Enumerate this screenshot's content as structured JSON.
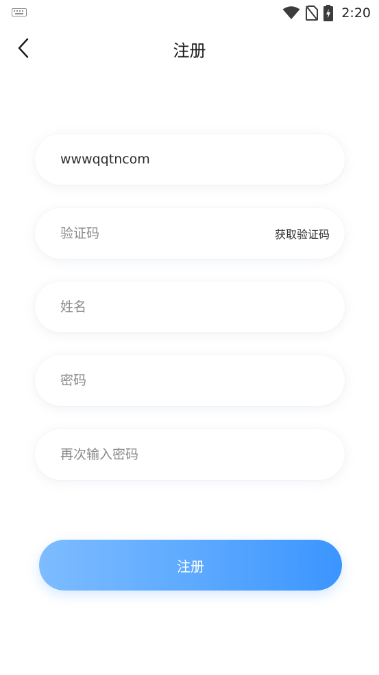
{
  "status_bar": {
    "time": "2:20",
    "icons": [
      "keyboard-icon",
      "wifi-icon",
      "no-sim-icon",
      "battery-charging-icon"
    ]
  },
  "header": {
    "back_icon": "chevron-left-icon",
    "title": "注册"
  },
  "form": {
    "account": {
      "value": "wwwqqtncom",
      "placeholder": ""
    },
    "verification_code": {
      "value": "",
      "placeholder": "验证码",
      "get_code_label": "获取验证码"
    },
    "name": {
      "value": "",
      "placeholder": "姓名"
    },
    "password": {
      "value": "",
      "placeholder": "密码"
    },
    "confirm_password": {
      "value": "",
      "placeholder": "再次输入密码"
    },
    "submit_label": "注册"
  },
  "colors": {
    "accent_start": "#7dbcff",
    "accent_end": "#3b95ff",
    "background": "#ffffff"
  }
}
